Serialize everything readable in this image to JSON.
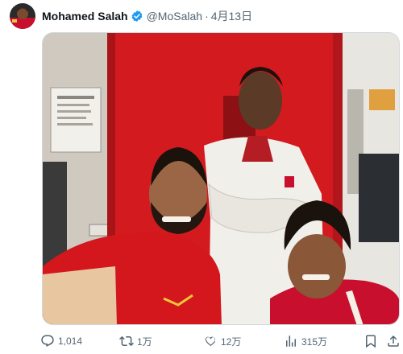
{
  "tweet": {
    "author_name": "Mohamed Salah",
    "handle": "@MoSalah",
    "separator": "·",
    "date": "4月13日",
    "verified": true
  },
  "actions": {
    "replies": "1,014",
    "retweets": "1万",
    "likes": "12万",
    "views": "315万"
  },
  "icons": {
    "verified": "verified-badge-icon",
    "reply": "comment-bubble-icon",
    "retweet": "retweet-icon",
    "like": "heart-icon",
    "views": "bar-chart-icon",
    "bookmark": "bookmark-icon",
    "share": "share-upload-icon"
  },
  "colors": {
    "verified_blue": "#1d9bf0",
    "muted_text": "#536471",
    "primary_text": "#0f1419"
  }
}
